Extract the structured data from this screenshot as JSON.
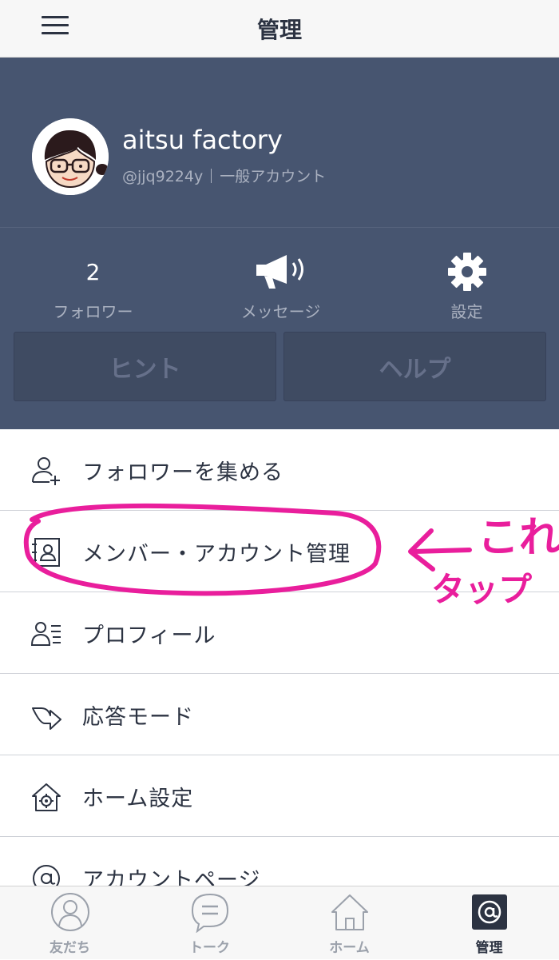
{
  "topbar": {
    "title": "管理"
  },
  "profile": {
    "name": "aitsu factory",
    "handle": "@jjq9224y",
    "account_type": "一般アカウント"
  },
  "stats": [
    {
      "value": "2",
      "label": "フォロワー"
    },
    {
      "icon": "megaphone-icon",
      "label": "メッセージ"
    },
    {
      "icon": "gear-icon",
      "label": "設定"
    }
  ],
  "buttons": {
    "hint": "ヒント",
    "help": "ヘルプ"
  },
  "menu": [
    {
      "icon": "add-user-icon",
      "label": "フォロワーを集める"
    },
    {
      "icon": "member-card-icon",
      "label": "メンバー・アカウント管理"
    },
    {
      "icon": "profile-list-icon",
      "label": "プロフィール"
    },
    {
      "icon": "reply-arrow-icon",
      "label": "応答モード"
    },
    {
      "icon": "home-gear-icon",
      "label": "ホーム設定"
    },
    {
      "icon": "at-icon",
      "label": "アカウントページ"
    }
  ],
  "tabs": [
    {
      "icon": "friends-icon",
      "label": "友だち"
    },
    {
      "icon": "chat-icon",
      "label": "トーク"
    },
    {
      "icon": "home-icon",
      "label": "ホーム"
    },
    {
      "icon": "at-icon",
      "label": "管理",
      "active": true
    }
  ],
  "annotation": {
    "text_line1": "これ",
    "text_line2": "タップ",
    "color": "#e91e9c"
  },
  "colors": {
    "header_bg": "#475570",
    "text_dark": "#2c3342",
    "muted": "#aab1c0"
  }
}
